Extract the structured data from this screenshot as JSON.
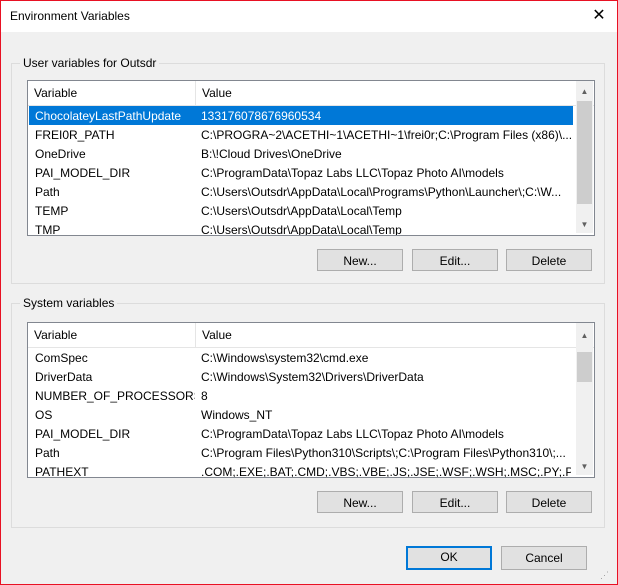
{
  "window": {
    "title": "Environment Variables",
    "close_glyph": "✕"
  },
  "user": {
    "label": "User variables for Outsdr",
    "col_variable": "Variable",
    "col_value": "Value",
    "rows": [
      {
        "name": "ChocolateyLastPathUpdate",
        "value": "133176078676960534",
        "selected": true
      },
      {
        "name": "FREI0R_PATH",
        "value": "C:\\PROGRA~2\\ACETHI~1\\ACETHI~1\\frei0r;C:\\Program Files (x86)\\..."
      },
      {
        "name": "OneDrive",
        "value": "B:\\!Cloud Drives\\OneDrive"
      },
      {
        "name": "PAI_MODEL_DIR",
        "value": "C:\\ProgramData\\Topaz Labs LLC\\Topaz Photo AI\\models"
      },
      {
        "name": "Path",
        "value": "C:\\Users\\Outsdr\\AppData\\Local\\Programs\\Python\\Launcher\\;C:\\W..."
      },
      {
        "name": "TEMP",
        "value": "C:\\Users\\Outsdr\\AppData\\Local\\Temp"
      },
      {
        "name": "TMP",
        "value": "C:\\Users\\Outsdr\\AppData\\Local\\Temp"
      }
    ],
    "new_label": "New...",
    "edit_label": "Edit...",
    "delete_label": "Delete"
  },
  "system": {
    "label": "System variables",
    "col_variable": "Variable",
    "col_value": "Value",
    "rows": [
      {
        "name": "ComSpec",
        "value": "C:\\Windows\\system32\\cmd.exe"
      },
      {
        "name": "DriverData",
        "value": "C:\\Windows\\System32\\Drivers\\DriverData"
      },
      {
        "name": "NUMBER_OF_PROCESSORS",
        "value": "8"
      },
      {
        "name": "OS",
        "value": "Windows_NT"
      },
      {
        "name": "PAI_MODEL_DIR",
        "value": "C:\\ProgramData\\Topaz Labs LLC\\Topaz Photo AI\\models"
      },
      {
        "name": "Path",
        "value": "C:\\Program Files\\Python310\\Scripts\\;C:\\Program Files\\Python310\\;..."
      },
      {
        "name": "PATHEXT",
        "value": ".COM;.EXE;.BAT;.CMD;.VBS;.VBE;.JS;.JSE;.WSF;.WSH;.MSC;.PY;.PYW"
      }
    ],
    "new_label": "New...",
    "edit_label": "Edit...",
    "delete_label": "Delete"
  },
  "ok_label": "OK",
  "cancel_label": "Cancel",
  "colors": {
    "selection": "#0078d7",
    "close_border": "#e81123"
  }
}
